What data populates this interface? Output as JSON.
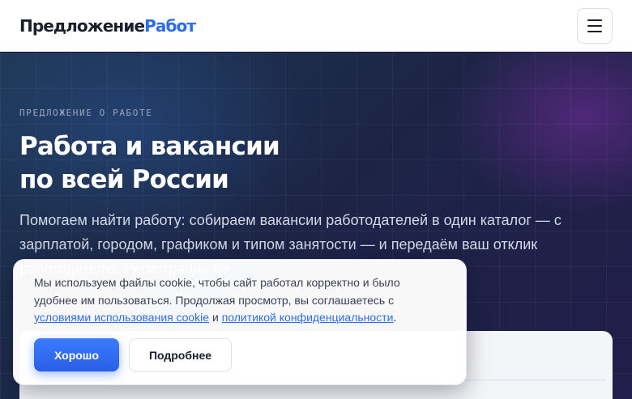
{
  "header": {
    "logo_part1": "Предложение",
    "logo_part2": "Работ",
    "menu_icon": "hamburger-icon"
  },
  "hero": {
    "eyebrow": "ПРЕДЛОЖЕНИЕ О РАБОТЕ",
    "title_line1": "Работа и вакансии",
    "title_line2": "по всей России",
    "lead": "Помогаем найти работу: собираем вакансии работодателей в один каталог — с зарплатой, городом, графиком и типом занятости — и передаём ваш отклик работодателю. Регистрация не"
  },
  "cookie_banner": {
    "text_before": "Мы используем файлы cookie, чтобы сайт работал корректно и было удобнее им пользоваться. Продолжая просмотр, вы соглашаетесь с ",
    "link_terms": "условиями использования cookie",
    "text_and": " и ",
    "link_privacy": "политикой конфиденциальности",
    "text_end": ".",
    "accept_label": "Хорошо",
    "more_label": "Подробнее"
  },
  "colors": {
    "accent": "#2d6cf0",
    "hero_bg": "#1c2546",
    "text_dark": "#1b1e2b"
  }
}
